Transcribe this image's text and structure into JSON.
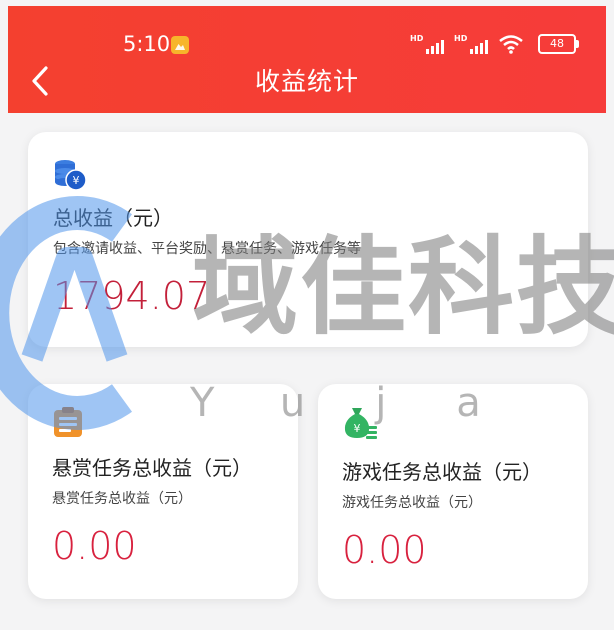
{
  "status_bar": {
    "time": "5:10",
    "battery": "48"
  },
  "header": {
    "title": "收益统计"
  },
  "total": {
    "title": "总收益（元）",
    "subtitle": "包含邀请收益、平台奖励、悬赏任务、游戏任务等",
    "value": "1794.07"
  },
  "bounty": {
    "title": "悬赏任务总收益（元）",
    "subtitle": "悬赏任务总收益（元）",
    "value": "0.00"
  },
  "game": {
    "title": "游戏任务总收益（元）",
    "subtitle": "游戏任务总收益（元）",
    "value": "0.00"
  },
  "watermark": {
    "text": "域佳科技",
    "sub": "Yuja"
  },
  "colors": {
    "header": "#f4402f",
    "value": "#d8213e",
    "background": "#f4f4f5"
  }
}
